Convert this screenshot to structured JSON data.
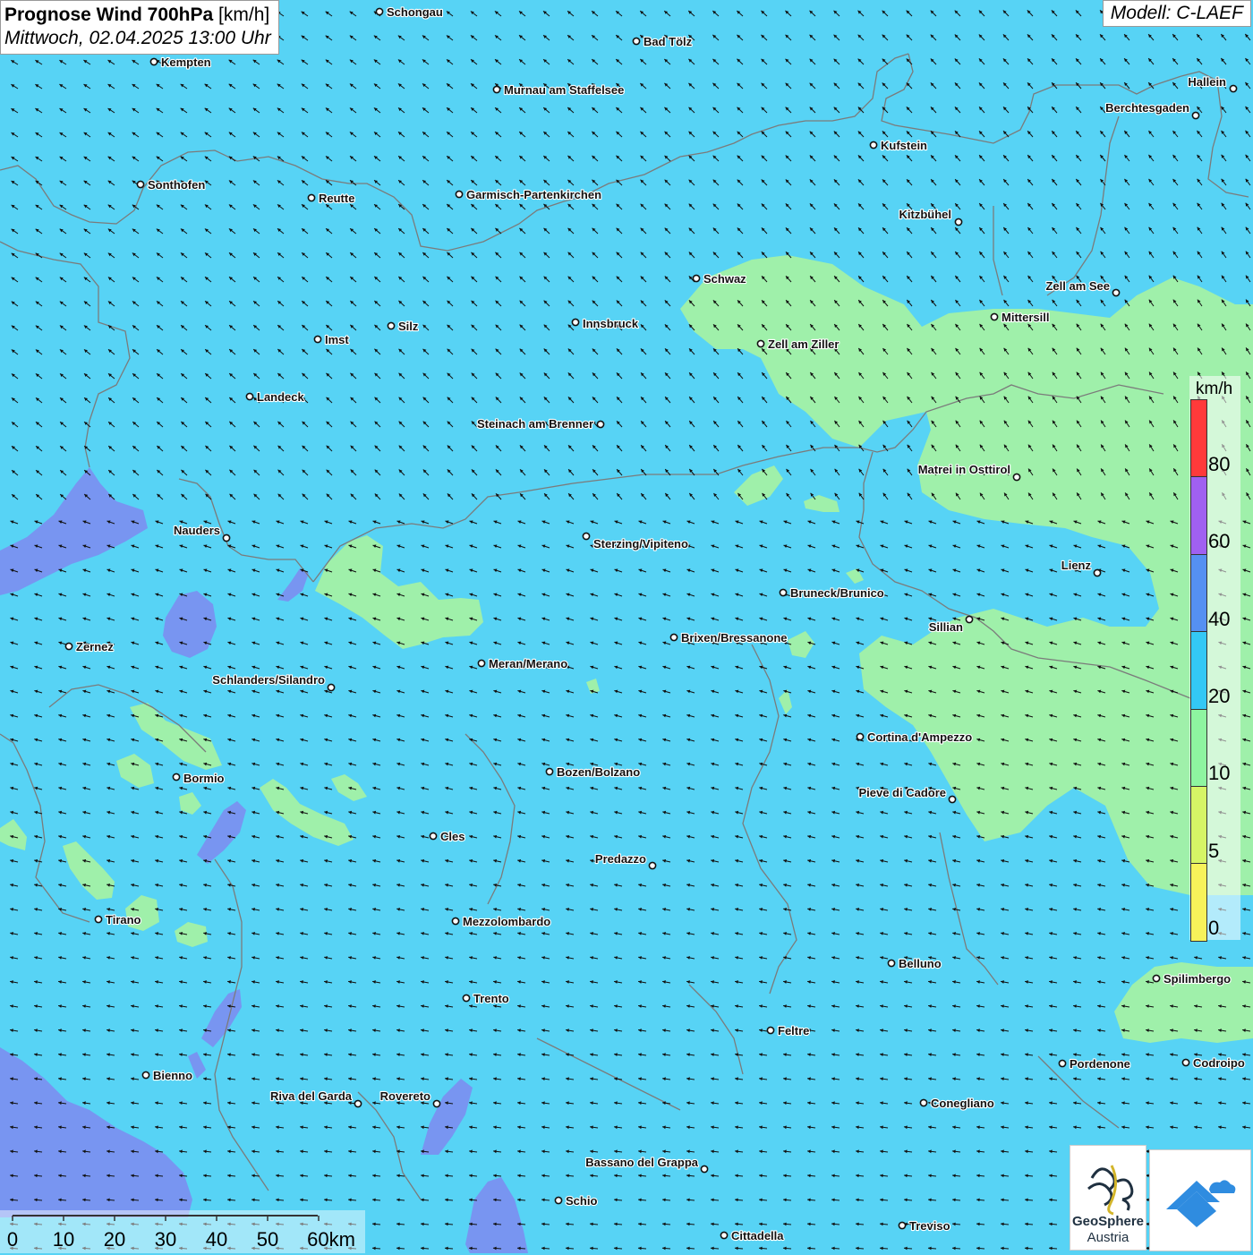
{
  "header": {
    "title_bold": "Prognose Wind 700hPa",
    "title_unit": "[km/h]",
    "datetime": "Mittwoch, 02.04.2025 13:00 Uhr"
  },
  "model": "Modell: C-LAEF",
  "legend": {
    "unit": "km/h",
    "labels": [
      "80",
      "60",
      "40",
      "20",
      "10",
      "5",
      "0"
    ],
    "colors": [
      "#ff3a3a",
      "#a060f0",
      "#5590f2",
      "#33c8f5",
      "#8ef5a0",
      "#d6f566",
      "#f7f25a"
    ]
  },
  "fill_colors": {
    "base": "#57d3f5",
    "green": "#a5f2a3",
    "purple": "#7b8ff0",
    "border": "#7b7b7b"
  },
  "wind": {
    "direction": "from east-southeast",
    "arrow_color": "#111111"
  },
  "cities": [
    {
      "name": "Schongau"
    },
    {
      "name": "Kempten"
    },
    {
      "name": "Bad Tölz"
    },
    {
      "name": "Murnau am Staffelsee"
    },
    {
      "name": "Hallein"
    },
    {
      "name": "Berchtesgaden"
    },
    {
      "name": "Kufstein"
    },
    {
      "name": "Sonthofen"
    },
    {
      "name": "Reutte"
    },
    {
      "name": "Garmisch-Partenkirchen"
    },
    {
      "name": "Kitzbühel"
    },
    {
      "name": "Schwaz"
    },
    {
      "name": "Zell am See"
    },
    {
      "name": "Mittersill"
    },
    {
      "name": "Imst"
    },
    {
      "name": "Silz"
    },
    {
      "name": "Innsbruck"
    },
    {
      "name": "Zell am Ziller"
    },
    {
      "name": "Landeck"
    },
    {
      "name": "Steinach am Brenner"
    },
    {
      "name": "Matrei in Osttirol"
    },
    {
      "name": "Nauders"
    },
    {
      "name": "Sterzing/Vipiteno"
    },
    {
      "name": "Lienz"
    },
    {
      "name": "Bruneck/Brunico"
    },
    {
      "name": "Sillian"
    },
    {
      "name": "Zernez"
    },
    {
      "name": "Brixen/Bressanone"
    },
    {
      "name": "Meran/Merano"
    },
    {
      "name": "Schlanders/Silandro"
    },
    {
      "name": "Cortina d'Ampezzo"
    },
    {
      "name": "Bozen/Bolzano"
    },
    {
      "name": "Bormio"
    },
    {
      "name": "Pieve di Cadore"
    },
    {
      "name": "Cles"
    },
    {
      "name": "Predazzo"
    },
    {
      "name": "Tirano"
    },
    {
      "name": "Mezzolombardo"
    },
    {
      "name": "Belluno"
    },
    {
      "name": "Spilimbergo"
    },
    {
      "name": "Trento"
    },
    {
      "name": "Feltre"
    },
    {
      "name": "Pordenone"
    },
    {
      "name": "Codroipo"
    },
    {
      "name": "Bienno"
    },
    {
      "name": "Riva del Garda"
    },
    {
      "name": "Rovereto"
    },
    {
      "name": "Conegliano"
    },
    {
      "name": "Bassano del Grappa"
    },
    {
      "name": "Schio"
    },
    {
      "name": "Treviso"
    },
    {
      "name": "Cittadella"
    }
  ],
  "scale": {
    "labels": [
      "0",
      "10",
      "20",
      "30",
      "40",
      "50",
      "60km"
    ]
  },
  "logos": {
    "geosphere_line1": "GeoSphere",
    "geosphere_line2": "Austria"
  }
}
